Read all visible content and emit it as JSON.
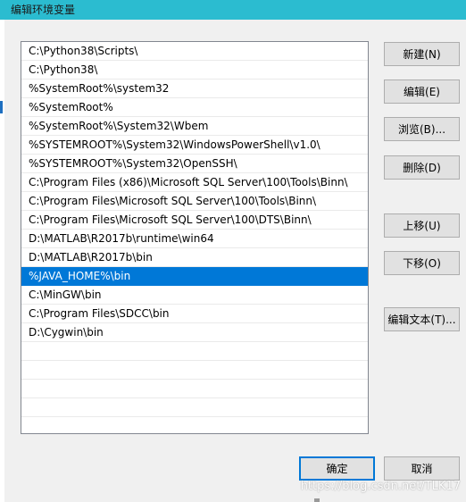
{
  "window": {
    "title": "编辑环境变量"
  },
  "list": {
    "items": [
      "C:\\Python38\\Scripts\\",
      "C:\\Python38\\",
      "%SystemRoot%\\system32",
      "%SystemRoot%",
      "%SystemRoot%\\System32\\Wbem",
      "%SYSTEMROOT%\\System32\\WindowsPowerShell\\v1.0\\",
      "%SYSTEMROOT%\\System32\\OpenSSH\\",
      "C:\\Program Files (x86)\\Microsoft SQL Server\\100\\Tools\\Binn\\",
      "C:\\Program Files\\Microsoft SQL Server\\100\\Tools\\Binn\\",
      "C:\\Program Files\\Microsoft SQL Server\\100\\DTS\\Binn\\",
      "D:\\MATLAB\\R2017b\\runtime\\win64",
      "D:\\MATLAB\\R2017b\\bin",
      "%JAVA_HOME%\\bin",
      "C:\\MinGW\\bin",
      "C:\\Program Files\\SDCC\\bin",
      "D:\\Cygwin\\bin"
    ],
    "selected_index": 12
  },
  "buttons": {
    "new": "新建(N)",
    "edit": "编辑(E)",
    "browse": "浏览(B)...",
    "delete": "删除(D)",
    "move_up": "上移(U)",
    "move_down": "下移(O)",
    "edit_text": "编辑文本(T)...",
    "ok": "确定",
    "cancel": "取消"
  },
  "watermark": "https://blog.csdn.net/TLK17",
  "colors": {
    "titlebar": "#2bbcd0",
    "selection": "#0078d7",
    "dialog_bg": "#f0f0f0"
  }
}
